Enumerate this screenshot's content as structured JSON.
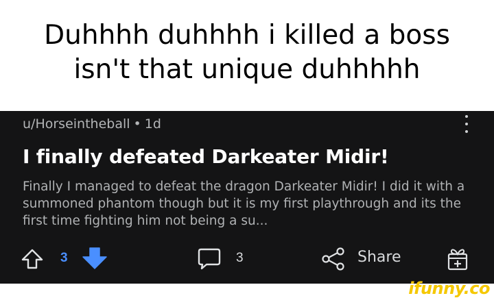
{
  "caption": {
    "text": "Duhhhh duhhhh i killed a boss isn't that unique duhhhhh"
  },
  "post": {
    "author": "u/Horseintheball",
    "separator": "•",
    "age": "1d",
    "title": "I finally defeated Darkeater Midir!",
    "body": "Finally I managed to defeat the dragon Darkeater Midir! I did it with a summoned phantom though but it is my first playthrough and its the first time fighting him not being a su..."
  },
  "actions": {
    "upvote_count": "3",
    "comment_count": "3",
    "share_label": "Share"
  },
  "icons": {
    "upvote": "arrow-up-outline-icon",
    "downvote": "arrow-down-filled-icon",
    "comment": "speech-bubble-icon",
    "share": "share-nodes-icon",
    "award": "gift-icon",
    "more": "kebab-menu-icon"
  },
  "colors": {
    "post_background": "#141415",
    "downvote_active": "#4a8fff",
    "watermark": "#f5c800"
  },
  "watermark": {
    "text": "ifunny.co"
  }
}
